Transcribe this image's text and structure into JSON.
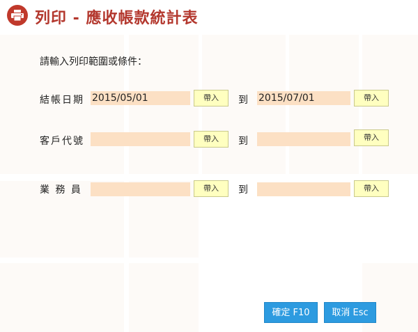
{
  "header": {
    "title": "列印 - 應收帳款統計表",
    "icon": "printer-icon",
    "accent": "#c0392b"
  },
  "prompt": "請輸入列印範圍或條件：",
  "rows": [
    {
      "label": "結帳日期",
      "from_value": "2015/05/01",
      "to_value": "2015/07/01"
    },
    {
      "label": "客戶代號",
      "from_value": "",
      "to_value": ""
    },
    {
      "label": "業 務 員",
      "from_value": "",
      "to_value": ""
    }
  ],
  "bring_label": "帶入",
  "to_label": "到",
  "buttons": {
    "confirm": "確定 F10",
    "cancel": "取消 Esc"
  },
  "colors": {
    "field_bg": "#fce0c4",
    "bring_bg": "#ffffc0",
    "action_bg": "#2d9be0"
  }
}
